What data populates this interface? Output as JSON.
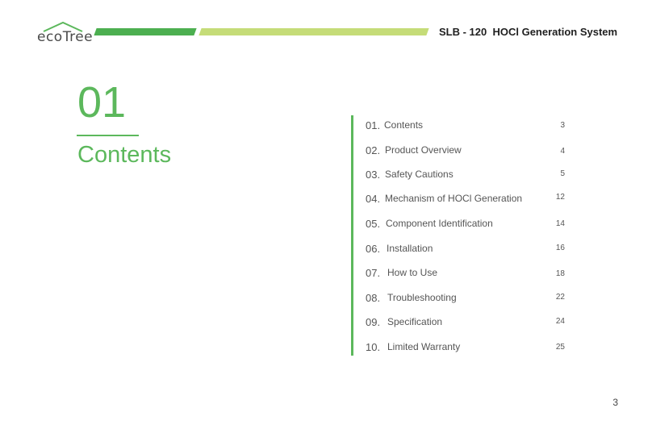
{
  "header": {
    "logo_text": "ecoTree",
    "document_title": "SLB - 120  HOCl Generation System"
  },
  "section": {
    "number": "01",
    "title": "Contents"
  },
  "toc": [
    {
      "num": "01.",
      "label": "Contents",
      "page": "3"
    },
    {
      "num": "02.",
      "label": "Product Overview",
      "page": "4"
    },
    {
      "num": "03.",
      "label": "Safety Cautions",
      "page": "5"
    },
    {
      "num": "04.",
      "label": "Mechanism of HOCl Generation",
      "page": "12"
    },
    {
      "num": "05.",
      "label": "Component Identification",
      "page": "14"
    },
    {
      "num": "06.",
      "label": "Installation",
      "page": "16"
    },
    {
      "num": "07.",
      "label": "How to Use",
      "page": "18"
    },
    {
      "num": "08.",
      "label": "Troubleshooting",
      "page": "22"
    },
    {
      "num": "09.",
      "label": "Specification",
      "page": "24"
    },
    {
      "num": "10.",
      "label": "Limited Warranty",
      "page": "25"
    }
  ],
  "footer": {
    "page_number": "3"
  },
  "colors": {
    "accent_green": "#5cb85c",
    "band_light": "#c5dc78"
  }
}
